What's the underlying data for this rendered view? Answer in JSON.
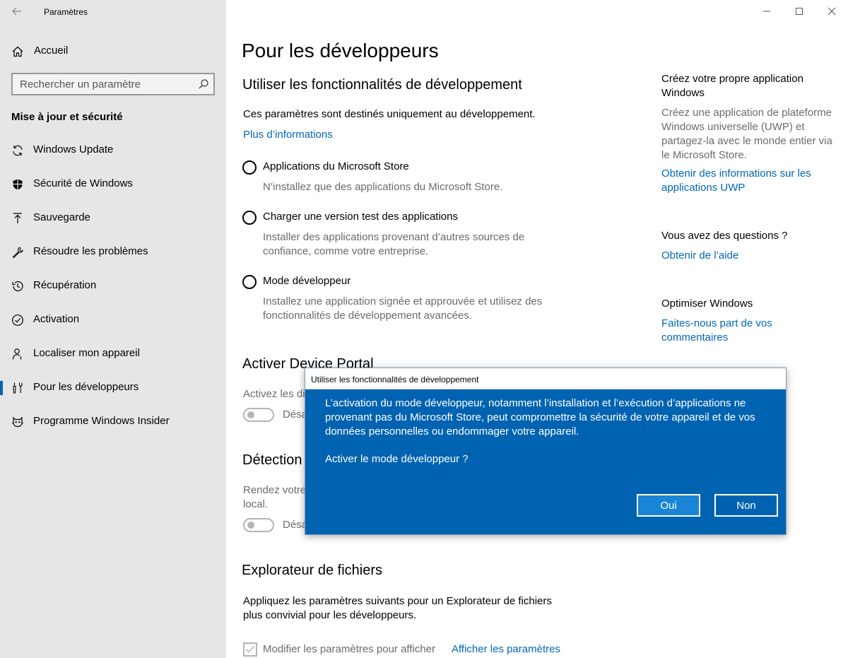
{
  "window": {
    "title": "Paramètres"
  },
  "sidebar": {
    "home_label": "Accueil",
    "search_placeholder": "Rechercher un paramètre",
    "section_title": "Mise à jour et sécurité",
    "items": [
      {
        "label": "Windows Update",
        "icon": "sync-icon"
      },
      {
        "label": "Sécurité de Windows",
        "icon": "shield-icon"
      },
      {
        "label": "Sauvegarde",
        "icon": "upload-arrow-icon"
      },
      {
        "label": "Résoudre les problèmes",
        "icon": "wrench-icon"
      },
      {
        "label": "Récupération",
        "icon": "history-icon"
      },
      {
        "label": "Activation",
        "icon": "check-circle-icon"
      },
      {
        "label": "Localiser mon appareil",
        "icon": "person-pin-icon"
      },
      {
        "label": "Pour les développeurs",
        "icon": "developer-tools-icon",
        "active": true
      },
      {
        "label": "Programme Windows Insider",
        "icon": "insider-cat-icon"
      }
    ],
    "accent_color": "#0063b1"
  },
  "main": {
    "page_title": "Pour les développeurs",
    "dev_features": {
      "heading": "Utiliser les fonctionnalités de développement",
      "intro": "Ces paramètres sont destinés uniquement au développement.",
      "more_link": "Plus d’informations",
      "options": [
        {
          "label": "Applications du Microsoft Store",
          "desc": "N’installez que des applications du Microsoft Store."
        },
        {
          "label": "Charger une version test des applications",
          "desc": "Installer des applications provenant d’autres sources de confiance, comme votre entreprise."
        },
        {
          "label": "Mode développeur",
          "desc": "Installez une application signée et approuvée et utilisez des fonctionnalités de développement avancées."
        }
      ]
    },
    "device_portal": {
      "heading": "Activer Device Portal",
      "desc_partial": "Activez les di",
      "toggle_label": "Désa"
    },
    "discovery": {
      "heading": "Détection",
      "desc_partial_1": "Rendez votre",
      "desc_partial_2": "local.",
      "toggle_label": "Désa"
    },
    "file_explorer": {
      "heading": "Explorateur de fichiers",
      "desc": "Appliquez les paramètres suivants pour un Explorateur de fichiers plus convivial pour les développeurs.",
      "checkbox_label": "Modifier les paramètres pour afficher",
      "show_settings_link": "Afficher les paramètres"
    }
  },
  "right": {
    "create_app": {
      "title": "Créez votre propre application Windows",
      "desc": "Créez une application de plateforme Windows universelle (UWP) et partagez-la avec le monde entier via le Microsoft Store.",
      "link": "Obtenir des informations sur les applications UWP"
    },
    "questions": {
      "title": "Vous avez des questions ?",
      "link": "Obtenir de l’aide"
    },
    "optimize": {
      "title": "Optimiser Windows",
      "link": "Faites-nous part de vos commentaires"
    }
  },
  "dialog": {
    "title": "Utiliser les fonctionnalités de développement",
    "message": "L’activation du mode développeur, notamment l’installation et l’exécution d’applications ne provenant pas du Microsoft Store, peut compromettre la sécurité de votre appareil et de vos données personnelles ou endommager votre appareil.",
    "question": "Activer le mode développeur ?",
    "yes_label": "Oui",
    "no_label": "Non",
    "bg_color": "#0063b1"
  }
}
